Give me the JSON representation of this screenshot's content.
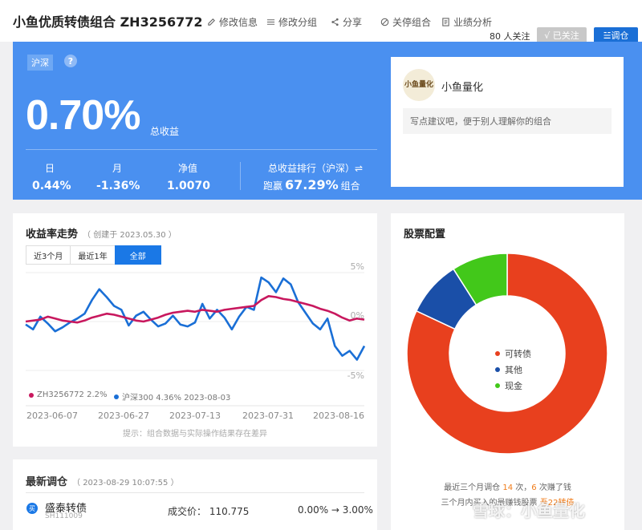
{
  "header": {
    "title": "小鱼优质转债组合 ZH3256772",
    "actions": [
      {
        "label": "修改信息",
        "icon": "edit-icon"
      },
      {
        "label": "修改分组",
        "icon": "list-icon"
      },
      {
        "label": "分享",
        "icon": "share-icon"
      },
      {
        "label": "关停组合",
        "icon": "ban-icon"
      },
      {
        "label": "业绩分析",
        "icon": "report-icon"
      }
    ],
    "followers": "80 人关注",
    "followed_label": "√ 已关注",
    "adjust_label": "☱调仓"
  },
  "banner": {
    "market": "沪深",
    "help": "?",
    "total_return": "0.70%",
    "total_return_label": "总收益",
    "stats": [
      {
        "label": "日",
        "value": "0.44%"
      },
      {
        "label": "月",
        "value": "-1.36%"
      },
      {
        "label": "净值",
        "value": "1.0070"
      }
    ],
    "rank_label": "总收益排行（沪深）⇌",
    "rank_prefix": "跑赢",
    "rank_value": "67.29%",
    "rank_suffix": "组合",
    "profile": {
      "avatar_text": "小鱼量化",
      "name": "小鱼量化",
      "placeholder": "写点建议吧，便于别人理解你的组合"
    }
  },
  "trend": {
    "title": "收益率走势",
    "created": "（ 创建于 2023.05.30 ）",
    "tabs": [
      "近3个月",
      "最近1年",
      "全部"
    ],
    "active_tab": 2,
    "legend": [
      "ZH3256772 2.2%",
      "沪深300 4.36% 2023-08-03"
    ],
    "note": "提示：组合数据与实际操作结果存在差异"
  },
  "chart_data": {
    "type": "line",
    "x_ticks": [
      "2023-06-07",
      "2023-06-27",
      "2023-07-13",
      "2023-07-31",
      "2023-08-16"
    ],
    "y_ticks": [
      "5%",
      "0%",
      "-5%"
    ],
    "ylim": [
      -5,
      5
    ],
    "series": [
      {
        "name": "ZH3256772",
        "color": "#c8185e",
        "values": [
          0.0,
          0.1,
          0.2,
          0.5,
          0.3,
          0.1,
          0.0,
          -0.1,
          0.1,
          0.4,
          0.6,
          0.8,
          0.7,
          0.5,
          0.3,
          0.1,
          0.0,
          0.2,
          0.4,
          0.7,
          0.9,
          1.0,
          1.1,
          1.0,
          1.2,
          1.1,
          1.0,
          1.2,
          1.3,
          1.4,
          1.5,
          1.6,
          2.2,
          2.6,
          2.5,
          2.3,
          2.2,
          2.0,
          1.8,
          1.6,
          1.3,
          1.1,
          0.8,
          0.4,
          0.1,
          0.3,
          0.2
        ]
      },
      {
        "name": "沪深300",
        "color": "#1a6fd6",
        "values": [
          -0.3,
          -0.8,
          0.5,
          -0.2,
          -1.0,
          -0.6,
          -0.1,
          0.3,
          0.8,
          2.2,
          3.3,
          2.5,
          1.6,
          1.2,
          -0.4,
          0.6,
          1.0,
          0.2,
          -0.5,
          -0.2,
          0.6,
          -0.3,
          -0.5,
          -0.1,
          1.8,
          0.3,
          1.2,
          0.4,
          -0.8,
          0.5,
          1.5,
          1.2,
          4.5,
          4.0,
          3.0,
          4.4,
          3.8,
          2.0,
          0.9,
          -0.2,
          -0.8,
          0.3,
          -2.5,
          -3.5,
          -3.0,
          -3.9,
          -2.5
        ]
      }
    ]
  },
  "allocation": {
    "title": "股票配置",
    "chart_data": {
      "type": "pie",
      "labels": [
        "可转债",
        "其他",
        "现金"
      ],
      "values": [
        82,
        9,
        9
      ],
      "colors": [
        "#e8401e",
        "#1a4fa8",
        "#42c81a"
      ]
    },
    "note_l1_a": "最近三个月调仓 ",
    "note_l1_n1": "14",
    "note_l1_b": " 次，",
    "note_l1_n2": "6",
    "note_l1_c": " 次赚了钱",
    "note_l2_a": "三个月内买入的最赚钱股票 ",
    "note_l2_b": "吾22转债"
  },
  "recent": {
    "title": "最新调仓",
    "time": "（ 2023-08-29 10:07:55 ）",
    "badge": "买",
    "stock": "盛泰转债",
    "code": "SH111009",
    "deal": "成交价： 110.775",
    "weight": "0.00% → 3.00%"
  },
  "watermark": "雪球：小鱼量化"
}
